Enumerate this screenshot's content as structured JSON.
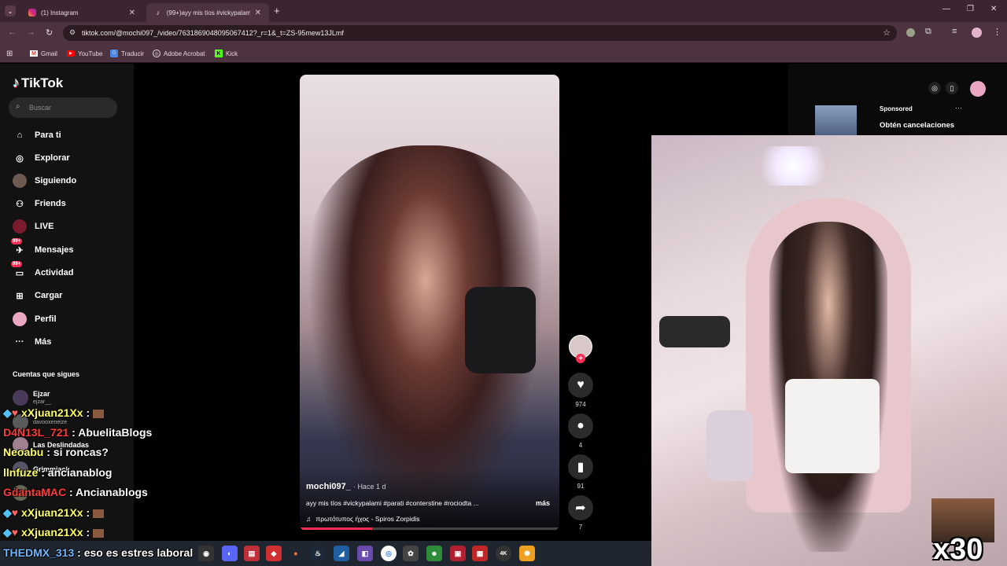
{
  "browser": {
    "tabs": [
      {
        "title": "(1) Instagram"
      },
      {
        "title": "(99+)ayy mis tíos #vickypalami"
      }
    ],
    "url": "tiktok.com/@mochi097_/video/7631869048095067412?_r=1&_t=ZS-95mew13JLmf",
    "bookmarks": [
      "Gmail",
      "YouTube",
      "Traducir",
      "Adobe Acrobat",
      "Kick"
    ]
  },
  "sidebar": {
    "logo": "TikTok",
    "search_placeholder": "Buscar",
    "nav": [
      {
        "label": "Para ti"
      },
      {
        "label": "Explorar"
      },
      {
        "label": "Siguiendo"
      },
      {
        "label": "Friends"
      },
      {
        "label": "LIVE"
      },
      {
        "label": "Mensajes",
        "badge": "99+"
      },
      {
        "label": "Actividad",
        "badge": "99+"
      },
      {
        "label": "Cargar"
      },
      {
        "label": "Perfil"
      },
      {
        "label": "Más"
      }
    ],
    "following_title": "Cuentas que sigues",
    "accounts": [
      {
        "name": "Ejzar",
        "handle": "ejzar__"
      },
      {
        "name": "",
        "handle": "davooxeneize"
      },
      {
        "name": "Las Deslindadas",
        "handle": ""
      },
      {
        "name": "Grimmjack",
        "handle": ""
      },
      {
        "name": "Puji2",
        "handle": ""
      }
    ]
  },
  "video": {
    "author": "mochi097_",
    "time": "Hace 1 d",
    "caption": "ayy mis tíos #vickypalami #parati #conterstine #rociodta ...",
    "more": "más",
    "sound": "πρωτότυπος ήχος - Spiros Zorpidis",
    "likes": "974",
    "comments": "4",
    "saves": "91",
    "shares": "7"
  },
  "ad": {
    "label": "Sponsored",
    "text": "Obtén cancelaciones"
  },
  "chat": [
    {
      "user": "xXjuan21Xx",
      "msg": ":",
      "color": "#ffff66"
    },
    {
      "user": "D4N13L_721",
      "msg": ": AbuelitaBlogs",
      "color": "#ff3b3b"
    },
    {
      "user": "Neoabu",
      "msg": ": si roncas?",
      "color": "#ffff66"
    },
    {
      "user": "llnfuze",
      "msg": ": ancianablog",
      "color": "#ffff66"
    },
    {
      "user": "GdantaMAC",
      "msg": ": Ancianablogs",
      "color": "#ff3b3b"
    },
    {
      "user": "xXjuan21Xx",
      "msg": ":",
      "color": "#ffff66"
    },
    {
      "user": "xXjuan21Xx",
      "msg": ":",
      "color": "#ffff66"
    },
    {
      "user": "THEDMX_313",
      "msg": ": eso es estres laboral",
      "color": "#6fb7ff"
    }
  ],
  "overlay": {
    "combo": "x30"
  },
  "colors": {
    "accent": "#fe2c55",
    "chrome": "#4d3340"
  }
}
